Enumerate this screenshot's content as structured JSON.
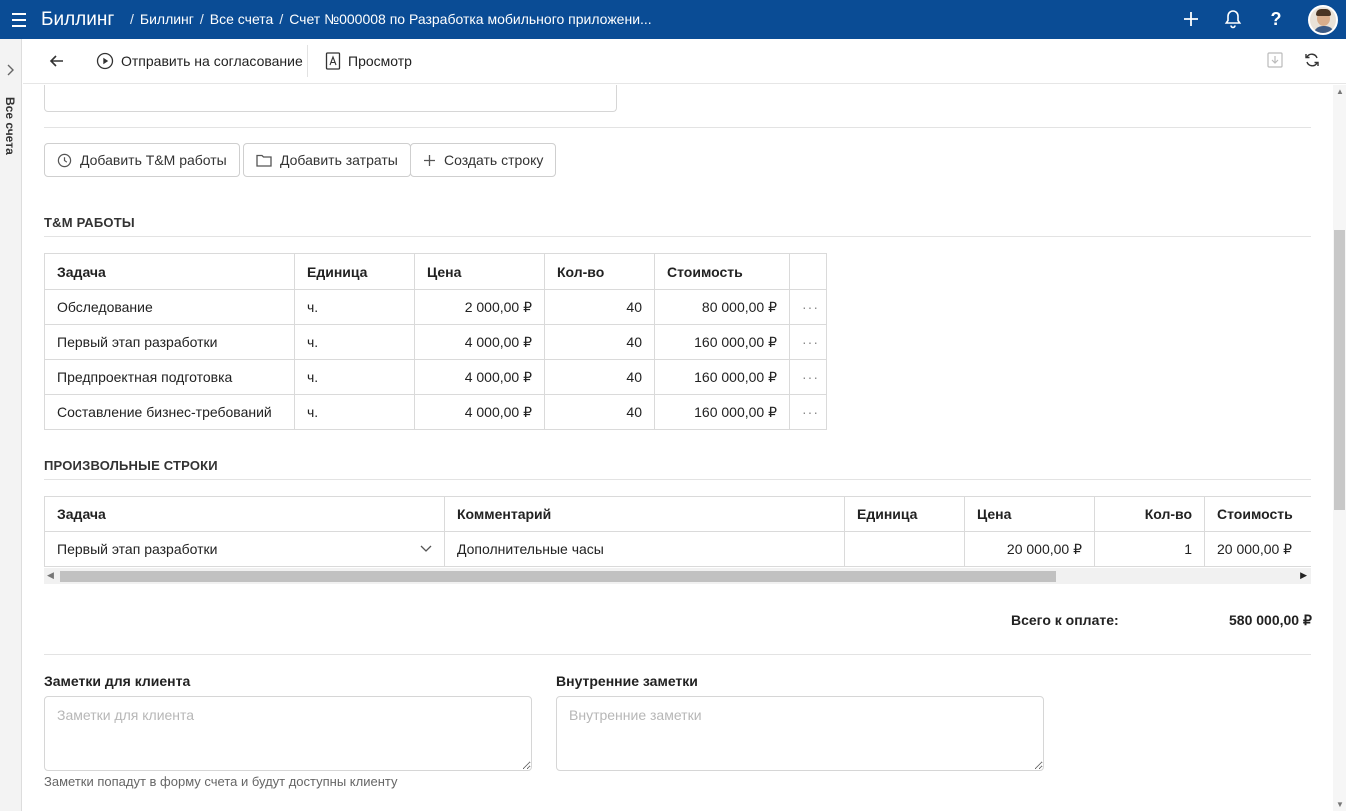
{
  "app": {
    "title": "Биллинг"
  },
  "breadcrumb": [
    {
      "label": "Биллинг"
    },
    {
      "label": "Все счета"
    },
    {
      "label": "Счет №000008 по Разработка мобильного приложени..."
    }
  ],
  "left_rail": {
    "label": "Все счета"
  },
  "toolbar": {
    "send_label": "Отправить на согласование",
    "preview_label": "Просмотр"
  },
  "actions": {
    "add_tm": "Добавить T&M работы",
    "add_expenses": "Добавить затраты",
    "create_row": "Создать строку"
  },
  "tm_section": {
    "title": "T&M РАБОТЫ",
    "columns": [
      "Задача",
      "Единица",
      "Цена",
      "Кол-во",
      "Стоимость"
    ],
    "rows": [
      {
        "task": "Обследование",
        "unit": "ч.",
        "price": "2 000,00 ₽",
        "qty": "40",
        "cost": "80 000,00 ₽"
      },
      {
        "task": "Первый этап разработки",
        "unit": "ч.",
        "price": "4 000,00 ₽",
        "qty": "40",
        "cost": "160 000,00 ₽"
      },
      {
        "task": "Предпроектная подготовка",
        "unit": "ч.",
        "price": "4 000,00 ₽",
        "qty": "40",
        "cost": "160 000,00 ₽"
      },
      {
        "task": "Составление бизнес-требований",
        "unit": "ч.",
        "price": "4 000,00 ₽",
        "qty": "40",
        "cost": "160 000,00 ₽"
      }
    ]
  },
  "custom_section": {
    "title": "ПРОИЗВОЛЬНЫЕ СТРОКИ",
    "columns": [
      "Задача",
      "Комментарий",
      "Единица",
      "Цена",
      "Кол-во",
      "Стоимость"
    ],
    "rows": [
      {
        "task": "Первый этап разработки",
        "comment": "Дополнительные часы",
        "unit": "",
        "price": "20 000,00 ₽",
        "qty": "1",
        "cost": "20 000,00 ₽"
      }
    ]
  },
  "total": {
    "label": "Всего к оплате:",
    "value": "580 000,00 ₽"
  },
  "notes": {
    "client_label": "Заметки для клиента",
    "client_placeholder": "Заметки для клиента",
    "internal_label": "Внутренние заметки",
    "internal_placeholder": "Внутренние заметки",
    "hint": "Заметки попадут в форму счета и будут доступны клиенту"
  }
}
